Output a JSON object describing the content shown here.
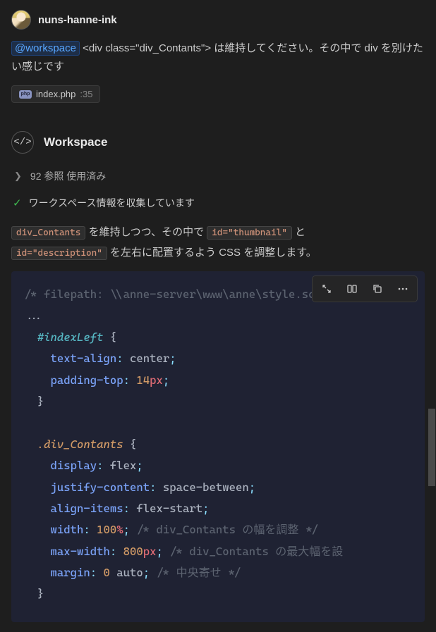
{
  "user": {
    "name": "nuns-hanne-ink"
  },
  "message": {
    "mention": "@workspace",
    "body_after_mention": " <div class=\"div_Contants\"> は維持してください。その中で div を別けたい感じです"
  },
  "file_badge": {
    "name": "index.php",
    "line": ":35"
  },
  "workspace": {
    "title": "Workspace",
    "references": "92 参照 使用済み",
    "status": "ワークスペース情報を収集しています"
  },
  "explanation": {
    "code1": "div_Contants",
    "text1": " を維持しつつ、その中で ",
    "code2": "id=\"thumbnail\"",
    "text2": " と ",
    "code3": "id=\"description\"",
    "text3": " を左右に配置するよう CSS を調整します。"
  },
  "code": {
    "filepath_comment": "/* filepath: \\\\anne-server\\www\\anne\\style.scss */",
    "ellipsis": "...",
    "sel_indexLeft": "#indexLeft",
    "prop_textalign": "text-align",
    "val_center": "center",
    "prop_paddingtop": "padding-top",
    "val_14": "14",
    "unit_px": "px",
    "sel_divContants": ".div_Contants",
    "prop_display": "display",
    "val_flex": "flex",
    "prop_justify": "justify-content",
    "val_spacebetween": "space-between",
    "prop_alignitems": "align-items",
    "val_flexstart": "flex-start",
    "prop_width": "width",
    "val_100": "100",
    "unit_pct": "%",
    "comment_width": "/* div_Contants の幅を調整 */",
    "prop_maxwidth": "max-width",
    "val_800": "800",
    "comment_maxwidth": "/* div_Contants の最大幅を設",
    "prop_margin": "margin",
    "val_0": "0",
    "val_auto": "auto",
    "comment_margin": "/* 中央寄せ */"
  },
  "toolbar_icons": [
    "insert-icon",
    "apply-icon",
    "copy-icon",
    "more-icon"
  ]
}
